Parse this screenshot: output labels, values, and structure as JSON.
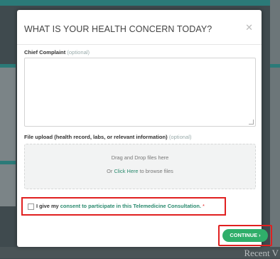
{
  "background": {
    "recent_heading": "Recent V"
  },
  "modal": {
    "title": "WHAT IS YOUR HEALTH CONCERN TODAY?",
    "close_icon": "close-icon",
    "chief_complaint": {
      "label": "Chief Complaint",
      "optional": "(optional)",
      "value": ""
    },
    "file_upload": {
      "label": "File upload (health record, labs, or relevant information)",
      "optional": "(optional)",
      "drop_text": "Drag and Drop files here",
      "browse_prefix": "Or",
      "browse_link": "Click Here",
      "browse_suffix": "to browse files"
    },
    "consent": {
      "prefix": "I give my",
      "link": "consent to participate in this Telemedicine Consultation.",
      "required_mark": "*",
      "checked": false
    },
    "continue_button": {
      "label": "CONTINUE",
      "arrow": "›"
    }
  },
  "colors": {
    "accent_teal": "#2a8a6e",
    "button_green": "#2fae6a",
    "highlight_red": "#e02020"
  }
}
